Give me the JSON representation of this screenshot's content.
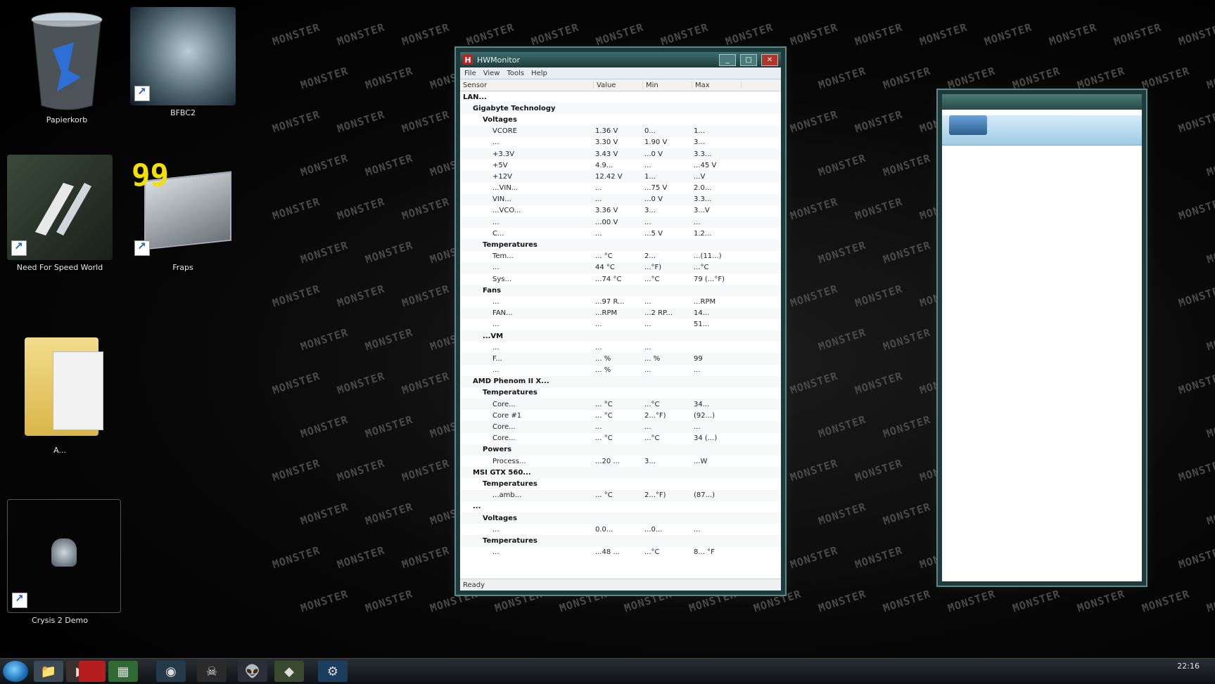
{
  "desktop": {
    "watermark_text": "MONSTER",
    "icons": [
      {
        "label": "Papierkorb",
        "icon": "recycle-bin-icon"
      },
      {
        "label": "BFBC2",
        "icon": "game-shortcut-icon"
      },
      {
        "label": "Need For Speed World",
        "icon": "game-shortcut-icon"
      },
      {
        "label": "Fraps",
        "icon": "fraps-icon",
        "badge": "99"
      },
      {
        "label": "A...",
        "icon": "folder-icon"
      },
      {
        "label": "Crysis 2 Demo",
        "icon": "game-shortcut-icon"
      }
    ]
  },
  "hwmonitor": {
    "title": "HWMonitor",
    "menu": [
      "File",
      "View",
      "Tools",
      "Help"
    ],
    "columns": [
      "Sensor",
      "Value",
      "Min",
      "Max"
    ],
    "rows": [
      {
        "name": "LAN...",
        "value": "",
        "min": "",
        "max": "",
        "level": 0
      },
      {
        "name": "Gigabyte Technology",
        "value": "",
        "min": "",
        "max": "",
        "level": 1
      },
      {
        "name": "Voltages",
        "value": "",
        "min": "",
        "max": "",
        "level": 2
      },
      {
        "name": "VCORE",
        "value": "1.36 V",
        "min": "0...",
        "max": "1...",
        "level": 3
      },
      {
        "name": "...",
        "value": "3.30 V",
        "min": "1.90 V",
        "max": "3...",
        "level": 3
      },
      {
        "name": "+3.3V",
        "value": "3.43 V",
        "min": "...0 V",
        "max": "3.3...",
        "level": 3
      },
      {
        "name": "+5V",
        "value": "4.9...",
        "min": "...",
        "max": "...45 V",
        "level": 3
      },
      {
        "name": "+12V",
        "value": "12.42 V",
        "min": "1...",
        "max": "...V",
        "level": 3
      },
      {
        "name": "...VIN...",
        "value": "...",
        "min": "...75 V",
        "max": "2.0...",
        "level": 3
      },
      {
        "name": "VIN...",
        "value": "...",
        "min": "...0 V",
        "max": "3.3...",
        "level": 3
      },
      {
        "name": "...VCO...",
        "value": "3.36 V",
        "min": "3...",
        "max": "3...V",
        "level": 3
      },
      {
        "name": "...",
        "value": "...00 V",
        "min": "...",
        "max": "...",
        "level": 3
      },
      {
        "name": "C...",
        "value": "...",
        "min": "...5 V",
        "max": "1.2...",
        "level": 3
      },
      {
        "name": "Temperatures",
        "value": "",
        "min": "",
        "max": "",
        "level": 2
      },
      {
        "name": "Tem...",
        "value": "... °C",
        "min": "2...",
        "max": "...(11...)",
        "level": 3
      },
      {
        "name": "...",
        "value": "44 °C",
        "min": "...°F)",
        "max": "...°C",
        "level": 3
      },
      {
        "name": "Sys...",
        "value": "...74 °C",
        "min": "...°C",
        "max": "79 (...°F)",
        "level": 3
      },
      {
        "name": "Fans",
        "value": "",
        "min": "",
        "max": "",
        "level": 2
      },
      {
        "name": "...",
        "value": "...97 R...",
        "min": "...",
        "max": "...RPM",
        "level": 3
      },
      {
        "name": "FAN...",
        "value": "...RPM",
        "min": "...2 RP...",
        "max": "14...",
        "level": 3
      },
      {
        "name": "...",
        "value": "...",
        "min": "...",
        "max": "51...",
        "level": 3
      },
      {
        "name": "...VM",
        "value": "",
        "min": "",
        "max": "",
        "level": 2
      },
      {
        "name": "...",
        "value": "...",
        "min": "...",
        "max": "",
        "level": 3
      },
      {
        "name": "F...",
        "value": "... %",
        "min": "... %",
        "max": "99",
        "level": 3
      },
      {
        "name": "...",
        "value": "... %",
        "min": "...",
        "max": "...",
        "level": 3
      },
      {
        "name": "AMD Phenom II X...",
        "value": "",
        "min": "",
        "max": "",
        "level": 1
      },
      {
        "name": "Temperatures",
        "value": "",
        "min": "",
        "max": "",
        "level": 2
      },
      {
        "name": "Core...",
        "value": "... °C",
        "min": "...°C",
        "max": "34...",
        "level": 3
      },
      {
        "name": "Core #1",
        "value": "... °C",
        "min": "2...°F)",
        "max": "(92...)",
        "level": 3
      },
      {
        "name": "Core...",
        "value": "...",
        "min": "...",
        "max": "...",
        "level": 3
      },
      {
        "name": "Core...",
        "value": "... °C",
        "min": "...°C",
        "max": "34 (...)",
        "level": 3
      },
      {
        "name": "Powers",
        "value": "",
        "min": "",
        "max": "",
        "level": 2
      },
      {
        "name": "Process...",
        "value": "...20 ...",
        "min": "3...",
        "max": "...W",
        "level": 3
      },
      {
        "name": "MSI GTX 560...",
        "value": "",
        "min": "",
        "max": "",
        "level": 1
      },
      {
        "name": "Temperatures",
        "value": "",
        "min": "",
        "max": "",
        "level": 2
      },
      {
        "name": "...amb...",
        "value": "... °C",
        "min": "2...°F)",
        "max": "(87...)",
        "level": 3
      },
      {
        "name": "...",
        "value": "",
        "min": "",
        "max": "",
        "level": 1
      },
      {
        "name": "Voltages",
        "value": "",
        "min": "",
        "max": "",
        "level": 2
      },
      {
        "name": "...",
        "value": "0.0...",
        "min": "...0...",
        "max": "...",
        "level": 3
      },
      {
        "name": "Temperatures",
        "value": "",
        "min": "",
        "max": "",
        "level": 2
      },
      {
        "name": "...",
        "value": "...48 ...",
        "min": "...°C",
        "max": "8... °F",
        "level": 3
      }
    ],
    "status": "Ready"
  },
  "second_window": {
    "title": ""
  },
  "taskbar": {
    "items": [
      {
        "icon": "windows-orb-icon"
      },
      {
        "icon": "explorer-icon"
      },
      {
        "icon": "media-player-icon"
      },
      {
        "icon": "adobe-icon"
      },
      {
        "icon": "hwmonitor-icon"
      },
      {
        "icon": "network-icon"
      },
      {
        "icon": "skull-icon"
      },
      {
        "icon": "alien-icon"
      },
      {
        "icon": "game-icon"
      },
      {
        "icon": "steam-icon"
      }
    ],
    "clock_time": "22:16"
  },
  "colors": {
    "window_frame": "#1e3a3a",
    "taskbar": "#1a1e22",
    "desktop": "#000000"
  }
}
